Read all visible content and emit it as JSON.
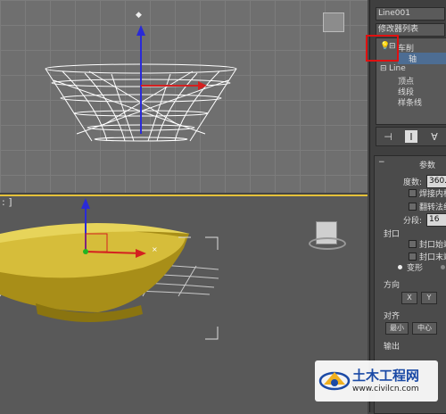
{
  "viewports": {
    "top_label": "",
    "persp_label": ": ]"
  },
  "panel": {
    "object_name": "Line001",
    "modifier_list": "修改器列表",
    "stack": [
      {
        "label": "车削",
        "selected": false
      },
      {
        "label": "轴",
        "selected": true
      },
      {
        "label": "Line",
        "selected": false
      },
      {
        "label": "顶点",
        "selected": false
      },
      {
        "label": "线段",
        "selected": false
      },
      {
        "label": "样条线",
        "selected": false
      }
    ],
    "toolbar_icons": [
      "pin-stack-icon",
      "show-end-result-icon",
      "make-unique-icon"
    ],
    "params": {
      "title": "参数",
      "degrees_label": "度数:",
      "degrees_value": "360.0",
      "weld_core": "焊接内核",
      "flip_normals": "翻转法线",
      "segments_label": "分段:",
      "segments_value": "16",
      "capping_label": "封口",
      "cap_start": "封口始端",
      "cap_end": "封口末端",
      "morph": "变形",
      "direction_label": "方向",
      "dir_x": "X",
      "dir_y": "Y",
      "align_label": "对齐",
      "align_min": "最小",
      "align_center": "中心",
      "output_label": "输出"
    }
  },
  "watermark": {
    "title": "土木工程网",
    "url": "www.civilcn.com"
  },
  "colors": {
    "highlight": "#e01010",
    "selected": "#4d6d93",
    "bowl": "#b39b1c"
  }
}
